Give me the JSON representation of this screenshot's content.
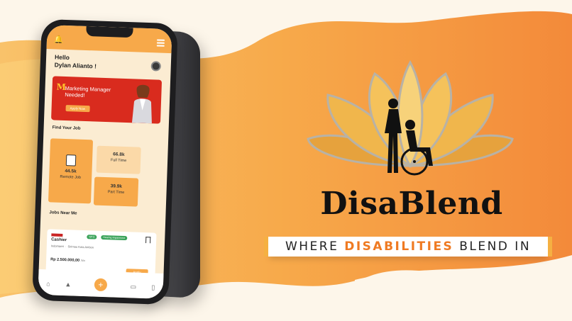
{
  "colors": {
    "accent": "#f7a94a",
    "orange": "#ef7a22",
    "banner_red": "#d92b1e",
    "background": "#fdf6ea"
  },
  "app": {
    "greeting_line1": "Hello",
    "greeting_line2": "Dylan Alianto !",
    "banner": {
      "logo": "M",
      "title": "Marketing Manager Needed!",
      "apply_label": "Apply Now"
    },
    "find_job_title": "Find Your Job",
    "stats": [
      {
        "value": "44.5k",
        "label": "Remote Job"
      },
      {
        "value": "66.8k",
        "label": "Full Time"
      },
      {
        "value": "39.9k",
        "label": "Part Time"
      }
    ],
    "jobs_near_title": "Jobs Near Me",
    "job": {
      "role": "Cashier",
      "company": "Indomaret",
      "location": "Sirimau Kota Ambon",
      "tags": [
        "WFO",
        "Hearing Impairment"
      ],
      "salary": "Rp 2.500.000,00",
      "salary_period": "/bln",
      "apply_label": "Apply"
    },
    "icons": {
      "bell": "bell-icon",
      "menu": "menu-icon",
      "home": "home-icon",
      "notification": "notification-icon",
      "add": "add-icon",
      "chat": "chat-icon",
      "bookmark": "bookmark-icon"
    }
  },
  "brand": {
    "name": "DisaBlend",
    "tagline_pre": "WHERE",
    "tagline_highlight": "DISABILITIES",
    "tagline_post": "BLEND IN"
  }
}
